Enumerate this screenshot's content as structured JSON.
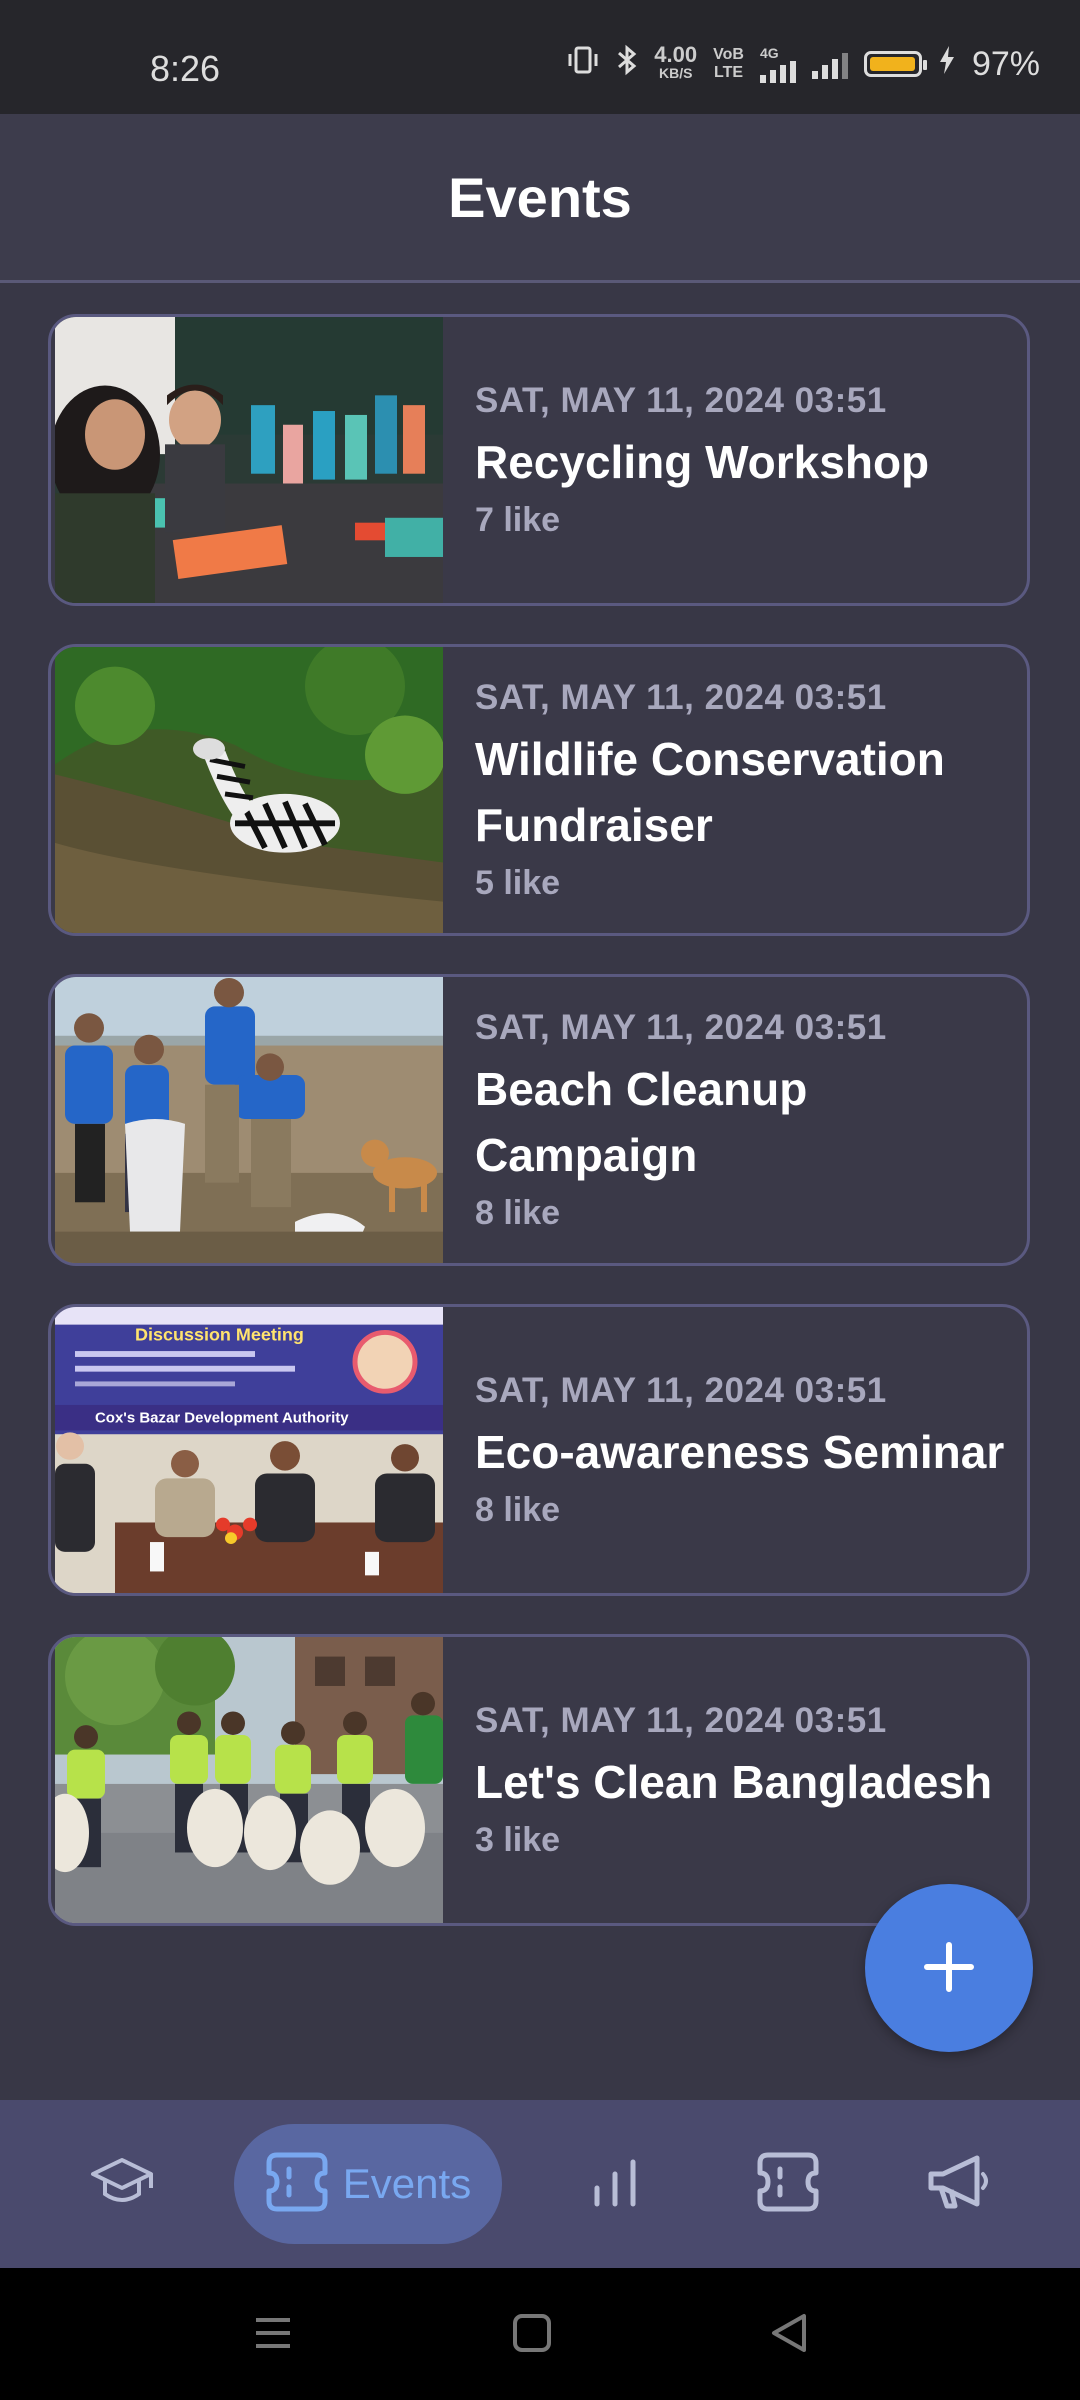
{
  "status_bar": {
    "time": "8:26",
    "net_speed": "4.00",
    "net_speed_unit": "KB/S",
    "volte_top": "VoB",
    "volte_bottom": "LTE",
    "network": "4G",
    "battery_percent": "97%",
    "battery_level": 0.97
  },
  "header": {
    "title": "Events"
  },
  "events": [
    {
      "date": "SAT, MAY 11, 2024 03:51",
      "title": "Recycling Workshop",
      "likes": "7 like"
    },
    {
      "date": "SAT, MAY 11, 2024 03:51",
      "title": "Wildlife Conservation Fundraiser",
      "likes": "5 like"
    },
    {
      "date": "SAT, MAY 11, 2024 03:51",
      "title": "Beach Cleanup Campaign",
      "likes": "8 like"
    },
    {
      "date": "SAT, MAY 11, 2024 03:51",
      "title": "Eco-awareness Seminar",
      "likes": "8 like"
    },
    {
      "date": "SAT, MAY 11, 2024 03:51",
      "title": "Let's Clean Bangladesh",
      "likes": "3 like"
    }
  ],
  "thumbs": {
    "seminar_banner_title": "Discussion Meeting",
    "seminar_banner_org": "Cox's Bazar Development Authority"
  },
  "fab": {
    "icon": "plus-icon"
  },
  "bottom_nav": {
    "items": [
      {
        "icon": "graduation-cap-icon"
      },
      {
        "icon": "ticket-icon",
        "label": "Events",
        "active": true
      },
      {
        "icon": "bar-chart-icon"
      },
      {
        "icon": "ticket-icon"
      },
      {
        "icon": "megaphone-icon"
      }
    ]
  },
  "colors": {
    "background": "#383746",
    "header": "#3d3c4c",
    "card_border": "#5a5980",
    "accent": "#4a7ee0",
    "nav_bg": "#4a4a6d",
    "nav_active_bg": "#5967a1",
    "nav_active_text": "#79a8f0"
  }
}
